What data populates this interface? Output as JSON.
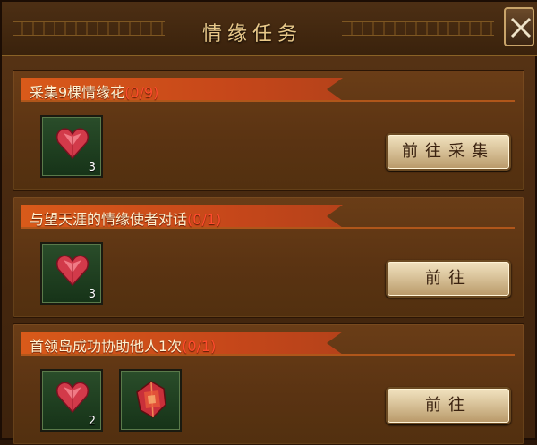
{
  "window": {
    "title": "情缘任务"
  },
  "colors": {
    "banner": "#d95a1a",
    "progress": "#ff4b2d",
    "title": "#e9c98a"
  },
  "tasks": [
    {
      "name": "采集9棵情缘花",
      "progress": "(0/9)",
      "button": "前往采集",
      "rewards": [
        {
          "icon": "red-heart-gem-icon",
          "count": "3"
        }
      ]
    },
    {
      "name": "与望天涯的情缘使者对话",
      "progress": "(0/1)",
      "button": "前往",
      "rewards": [
        {
          "icon": "red-heart-gem-icon",
          "count": "3"
        }
      ]
    },
    {
      "name": "首领岛成功协助他人1次",
      "progress": "(0/1)",
      "button": "前往",
      "rewards": [
        {
          "icon": "red-heart-gem-icon",
          "count": "2"
        },
        {
          "icon": "red-crystal-gem-icon",
          "count": ""
        }
      ]
    }
  ]
}
